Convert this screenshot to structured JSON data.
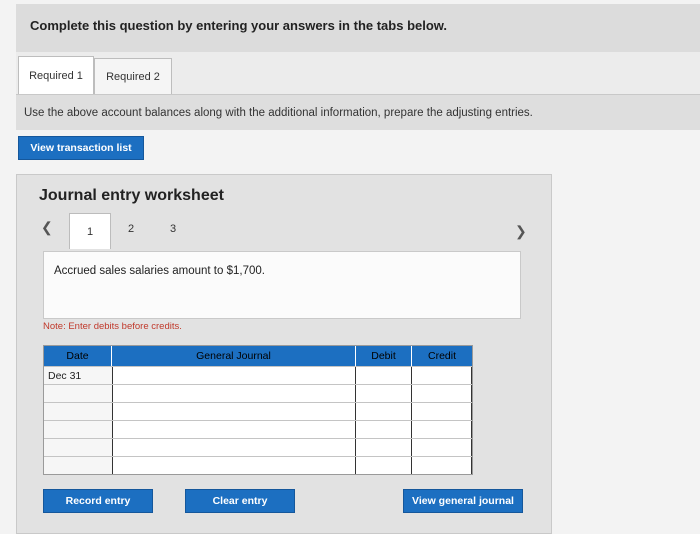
{
  "header": {
    "title": "Complete this question by entering your answers in the tabs below."
  },
  "tabs": [
    {
      "label": "Required 1",
      "active": true
    },
    {
      "label": "Required 2",
      "active": false
    }
  ],
  "instruction": "Use the above account balances along with the additional information, prepare the adjusting entries.",
  "buttons": {
    "view_transaction_list": "View transaction list",
    "record_entry": "Record entry",
    "clear_entry": "Clear entry",
    "view_general_journal": "View general journal"
  },
  "worksheet": {
    "title": "Journal entry worksheet",
    "pages": [
      "1",
      "2",
      "3"
    ],
    "current_page": "1",
    "description": "Accrued sales salaries amount to $1,700.",
    "note": "Note: Enter debits before credits.",
    "columns": {
      "date": "Date",
      "general_journal": "General Journal",
      "debit": "Debit",
      "credit": "Credit"
    },
    "rows": [
      {
        "date": "Dec 31",
        "account": "",
        "debit": "",
        "credit": ""
      },
      {
        "date": "",
        "account": "",
        "debit": "",
        "credit": ""
      },
      {
        "date": "",
        "account": "",
        "debit": "",
        "credit": ""
      },
      {
        "date": "",
        "account": "",
        "debit": "",
        "credit": ""
      },
      {
        "date": "",
        "account": "",
        "debit": "",
        "credit": ""
      },
      {
        "date": "",
        "account": "",
        "debit": "",
        "credit": ""
      }
    ]
  },
  "colors": {
    "accent": "#1c6fc1",
    "note": "#c0392b"
  },
  "icons": {
    "prev": "chevron-left-icon",
    "next": "chevron-right-icon"
  }
}
